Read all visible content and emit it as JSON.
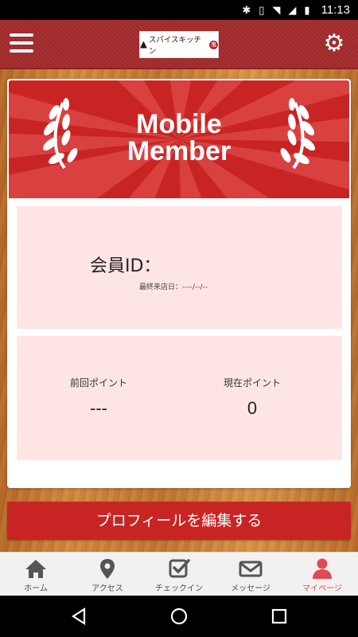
{
  "status": {
    "time": "11:13"
  },
  "header": {
    "logo_text": "スパイスキッチン",
    "logo_seal": "鬼"
  },
  "banner": {
    "title_line1": "Mobile",
    "title_line2": "Member"
  },
  "member": {
    "id_label": "会員ID：",
    "last_visit": "最終来店日：----/--/--"
  },
  "points": {
    "previous_label": "前回ポイント",
    "previous_value": "---",
    "current_label": "現在ポイント",
    "current_value": "0"
  },
  "edit_button": "プロフィールを編集する",
  "tabs": [
    {
      "label": "ホーム",
      "icon": "home-icon"
    },
    {
      "label": "アクセス",
      "icon": "map-pin-icon"
    },
    {
      "label": "チェックイン",
      "icon": "checkin-icon"
    },
    {
      "label": "メッセージ",
      "icon": "mail-icon"
    },
    {
      "label": "マイページ",
      "icon": "user-icon"
    }
  ],
  "colors": {
    "header": "#a32a2c",
    "accent": "#c92424",
    "panel": "#fee5e4",
    "active_tab": "#e04a58"
  }
}
